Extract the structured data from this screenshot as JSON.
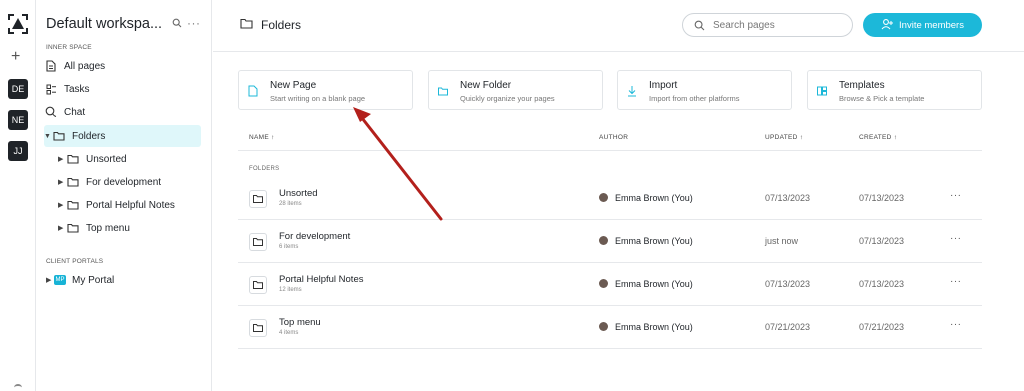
{
  "rail": {
    "workspaces": [
      "DE",
      "NE",
      "JJ"
    ]
  },
  "sidebar": {
    "workspace_name": "Default workspa...",
    "inner_space_label": "INNER SPACE",
    "items": [
      {
        "label": "All pages"
      },
      {
        "label": "Tasks"
      },
      {
        "label": "Chat"
      },
      {
        "label": "Folders"
      },
      {
        "label": "Unsorted"
      },
      {
        "label": "For development"
      },
      {
        "label": "Portal Helpful Notes"
      },
      {
        "label": "Top menu"
      }
    ],
    "client_portals_label": "CLIENT PORTALS",
    "portal": {
      "badge": "MP",
      "label": "My Portal"
    }
  },
  "header": {
    "title": "Folders",
    "search_placeholder": "Search pages",
    "invite_label": "Invite members"
  },
  "cards": [
    {
      "title": "New Page",
      "subtitle": "Start writing on a blank page"
    },
    {
      "title": "New Folder",
      "subtitle": "Quickly organize your pages"
    },
    {
      "title": "Import",
      "subtitle": "Import from other platforms"
    },
    {
      "title": "Templates",
      "subtitle": "Browse & Pick a template"
    }
  ],
  "table": {
    "columns": {
      "name": "NAME",
      "author": "AUTHOR",
      "updated": "UPDATED",
      "created": "CREATED"
    },
    "group_label": "FOLDERS",
    "rows": [
      {
        "name": "Unsorted",
        "count": "28 items",
        "author": "Emma Brown (You)",
        "updated": "07/13/2023",
        "created": "07/13/2023"
      },
      {
        "name": "For development",
        "count": "6 items",
        "author": "Emma Brown (You)",
        "updated": "just now",
        "created": "07/13/2023"
      },
      {
        "name": "Portal Helpful Notes",
        "count": "12 items",
        "author": "Emma Brown (You)",
        "updated": "07/13/2023",
        "created": "07/13/2023"
      },
      {
        "name": "Top menu",
        "count": "4 items",
        "author": "Emma Brown (You)",
        "updated": "07/21/2023",
        "created": "07/21/2023"
      }
    ]
  },
  "colors": {
    "accent": "#1cb8d9",
    "active_bg": "#dff7fa",
    "annotation_arrow": "#b3201c"
  }
}
